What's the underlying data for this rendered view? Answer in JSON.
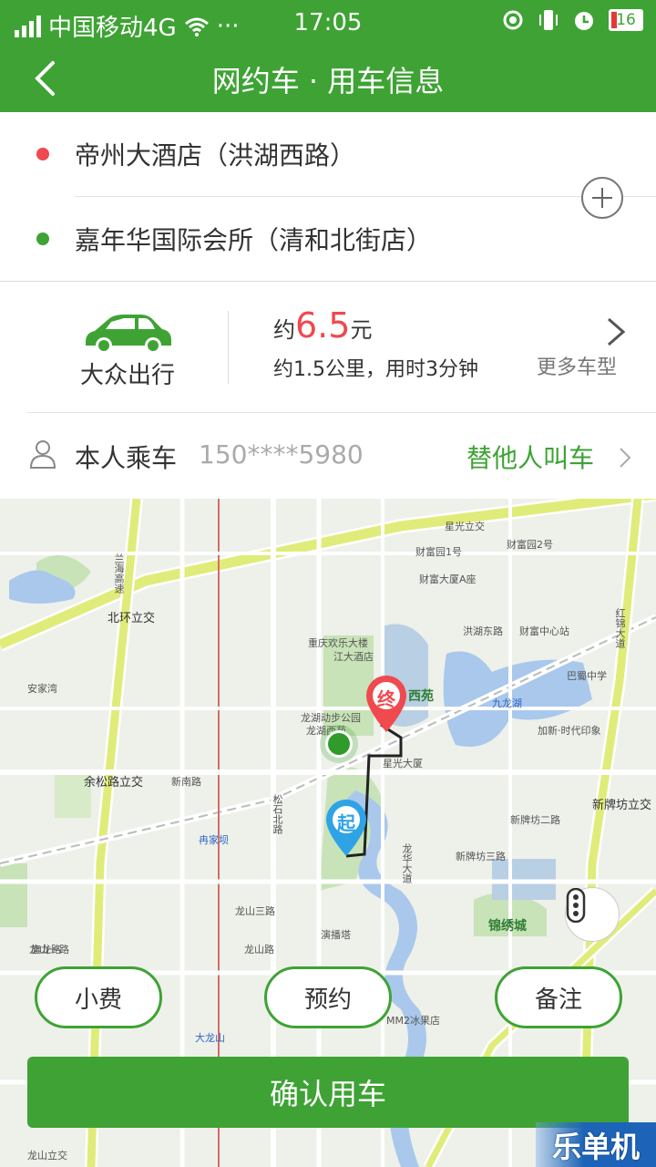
{
  "status_bar": {
    "carrier": "中国移动4G",
    "dots": "···",
    "time": "17:05",
    "battery": "16"
  },
  "header": {
    "title": "网约车 · 用车信息"
  },
  "addresses": {
    "from": {
      "text": "帝州大酒店（洪湖西路）",
      "color": "#f0494e"
    },
    "to": {
      "text": "嘉年华国际会所（清和北街店）",
      "color": "#3ea334"
    }
  },
  "car": {
    "type": "大众出行",
    "price_prefix": "约",
    "price_value": "6.5",
    "price_unit": "元",
    "distance": "约1.5公里，用时3分钟",
    "more_types": "更多车型"
  },
  "rider": {
    "label": "本人乘车",
    "phone": "150****5980",
    "call_for_other": "替他人叫车"
  },
  "map": {
    "labels": [
      {
        "text": "北环立交",
        "cls": "big"
      },
      {
        "text": "星光立交",
        "cls": ""
      },
      {
        "text": "财富园1号",
        "cls": ""
      },
      {
        "text": "财富园2号",
        "cls": ""
      },
      {
        "text": "重庆欢乐大楼",
        "cls": ""
      },
      {
        "text": "财富大厦A座",
        "cls": ""
      },
      {
        "text": "江大酒店",
        "cls": ""
      },
      {
        "text": "洪湖东路",
        "cls": ""
      },
      {
        "text": "财富中心站",
        "cls": ""
      },
      {
        "text": "九龙湖",
        "cls": "blue"
      },
      {
        "text": "西苑",
        "cls": "green"
      },
      {
        "text": "龙湖动步公园",
        "cls": ""
      },
      {
        "text": "龙湖西苑",
        "cls": ""
      },
      {
        "text": "星光大厦",
        "cls": ""
      },
      {
        "text": "余松路立交",
        "cls": "big"
      },
      {
        "text": "新南路",
        "cls": ""
      },
      {
        "text": "新牌坊立交",
        "cls": "big"
      },
      {
        "text": "新牌坊二路",
        "cls": ""
      },
      {
        "text": "新牌坊三路",
        "cls": ""
      },
      {
        "text": "锦绣城",
        "cls": "green"
      },
      {
        "text": "冉家坝",
        "cls": "blue"
      },
      {
        "text": "龙山三路",
        "cls": ""
      },
      {
        "text": "龙山一路",
        "cls": ""
      },
      {
        "text": "龙山路",
        "cls": ""
      },
      {
        "text": "大龙山",
        "cls": "blue"
      },
      {
        "text": "演播塔",
        "cls": ""
      },
      {
        "text": "MM2冰果店",
        "cls": ""
      },
      {
        "text": "巴蜀中学",
        "cls": ""
      },
      {
        "text": "加新·时代印象",
        "cls": ""
      },
      {
        "text": "安家湾",
        "cls": ""
      },
      {
        "text": "龙山立交",
        "cls": ""
      },
      {
        "text": "旗龙路",
        "cls": ""
      },
      {
        "text": "红锦大道",
        "cls": ""
      },
      {
        "text": "兰海高速",
        "cls": ""
      },
      {
        "text": "松石北路",
        "cls": ""
      },
      {
        "text": "龙华大道",
        "cls": ""
      }
    ],
    "start_marker": "起",
    "end_marker": "终"
  },
  "actions": {
    "tip": "小费",
    "reserve": "预约",
    "note": "备注",
    "confirm": "确认用车"
  },
  "watermark": "乐单机",
  "colors": {
    "brand_green": "#3ea334",
    "price_red": "#f0494e",
    "start_blue": "#2ea3e6",
    "end_red": "#f0494e"
  }
}
